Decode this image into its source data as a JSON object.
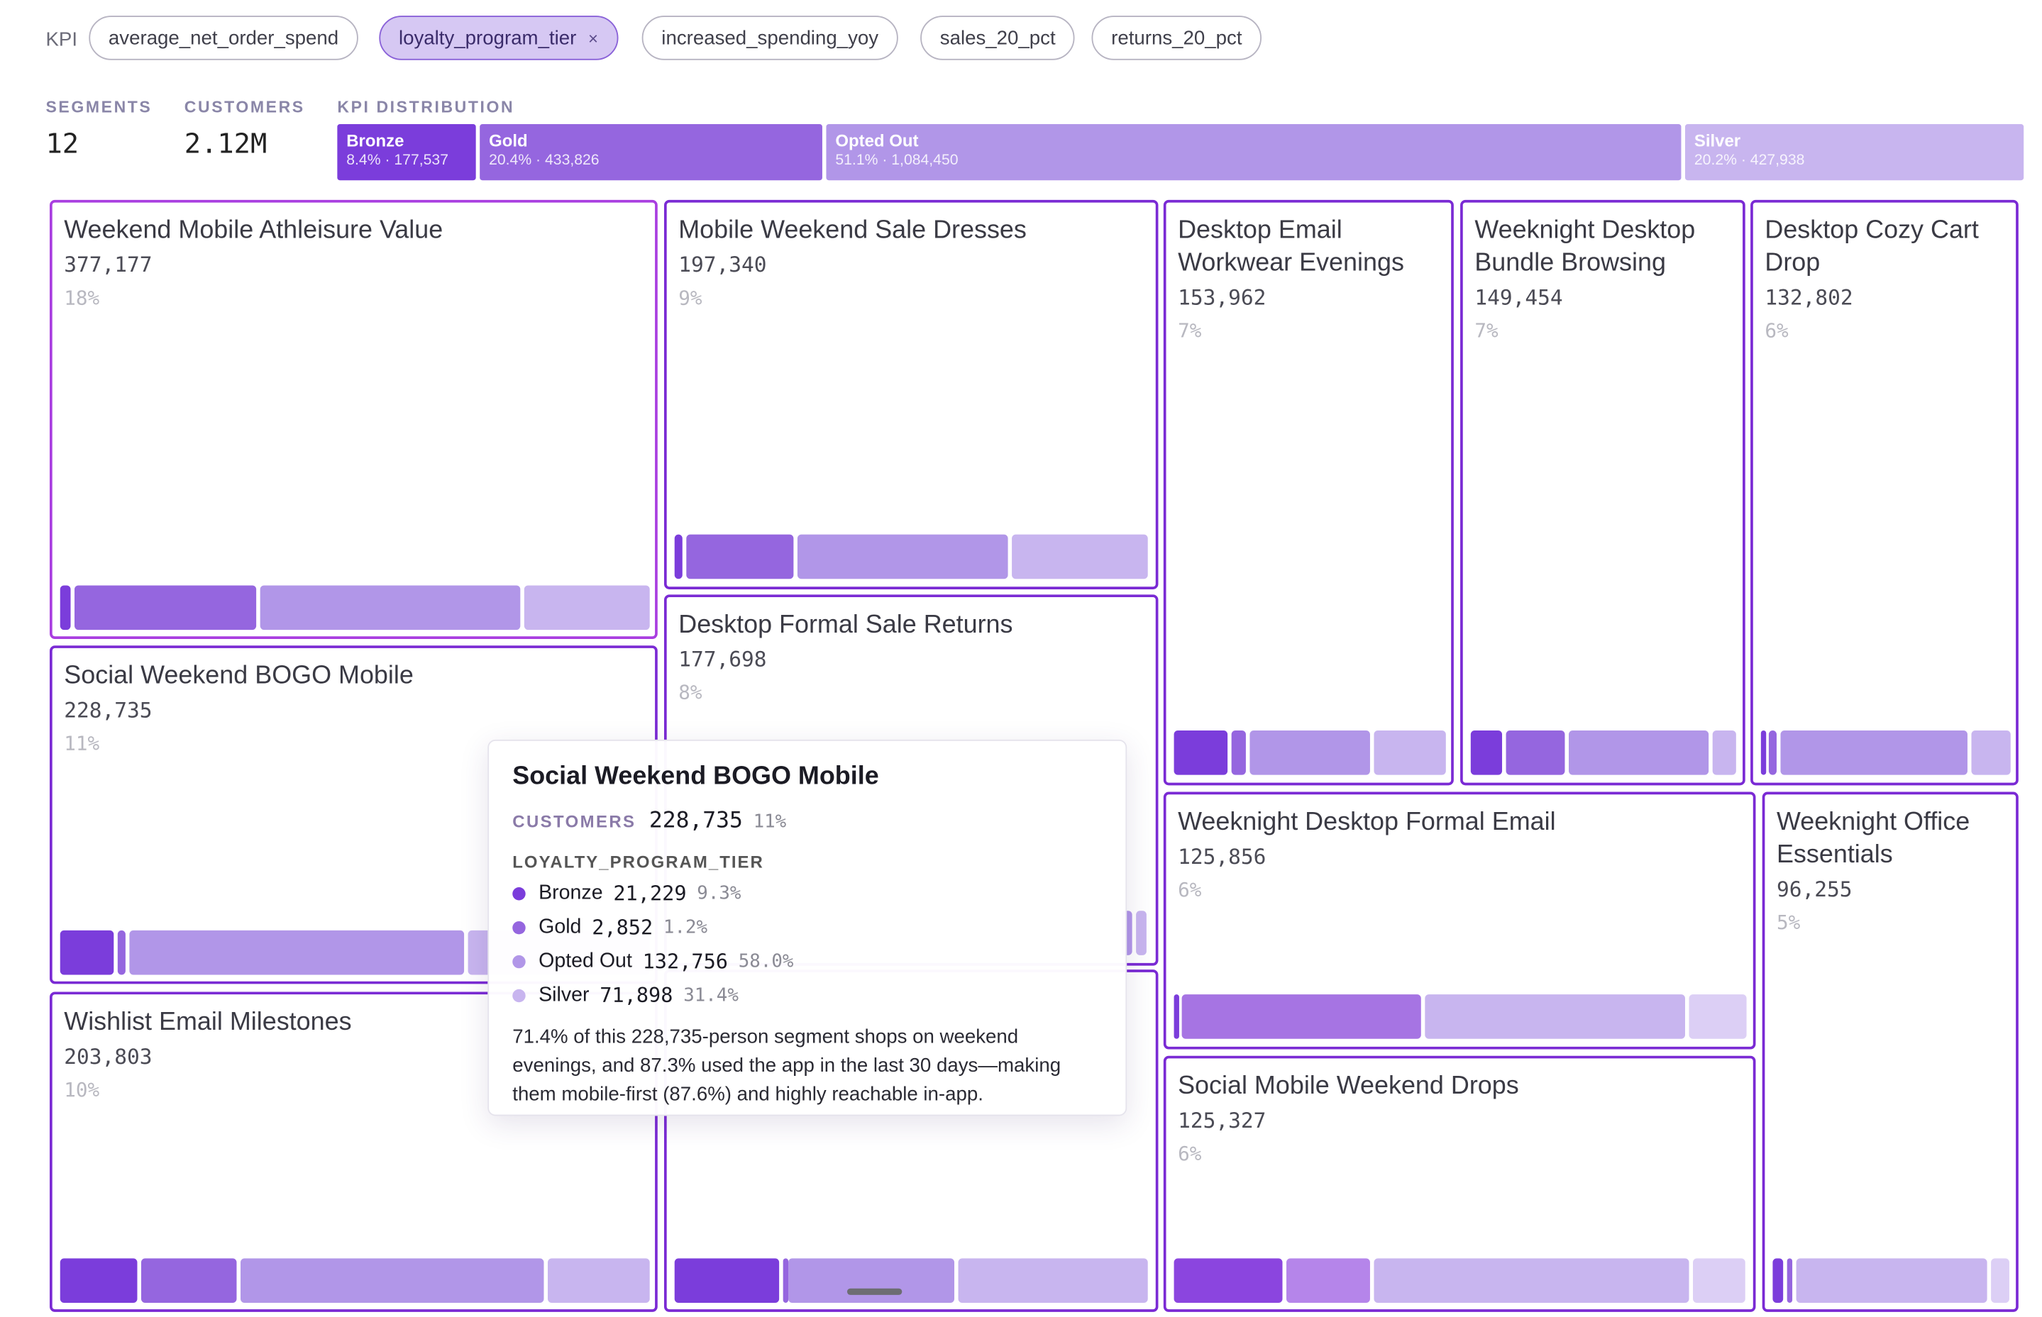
{
  "kpi_bar": {
    "label": "KPI",
    "pills": [
      {
        "label": "average_net_order_spend",
        "selected": false
      },
      {
        "label": "loyalty_program_tier",
        "selected": true,
        "close": "×"
      },
      {
        "label": "increased_spending_yoy",
        "selected": false
      },
      {
        "label": "sales_20_pct",
        "selected": false
      },
      {
        "label": "returns_20_pct",
        "selected": false
      }
    ]
  },
  "stats": {
    "segments_label": "SEGMENTS",
    "segments_value": "12",
    "customers_label": "CUSTOMERS",
    "customers_value": "2.12M",
    "distribution_label": "KPI DISTRIBUTION"
  },
  "distribution": [
    {
      "name": "Bronze",
      "sub": "8.4% · 177,537",
      "share": 0.084,
      "color": "#7b3ddb"
    },
    {
      "name": "Gold",
      "sub": "20.4% · 433,826",
      "share": 0.204,
      "color": "#9566df"
    },
    {
      "name": "Opted Out",
      "sub": "51.1% · 1,084,450",
      "share": 0.511,
      "color": "#b196e8"
    },
    {
      "name": "Silver",
      "sub": "20.2% · 427,938",
      "share": 0.202,
      "color": "#c8b5ef"
    }
  ],
  "segments": [
    {
      "title": "Weekend Mobile Athleisure Value",
      "customers": "377,177",
      "pct": "18%"
    },
    {
      "title": "Social Weekend BOGO Mobile",
      "customers": "228,735",
      "pct": "11%"
    },
    {
      "title": "Wishlist Email Milestones",
      "customers": "203,803",
      "pct": "10%"
    },
    {
      "title": "Mobile Weekend Sale Dresses",
      "customers": "197,340",
      "pct": "9%"
    },
    {
      "title": "Desktop Formal Sale Returns",
      "customers": "177,698",
      "pct": "8%"
    },
    {
      "title": "Desktop Email Workwear Evenings",
      "customers": "153,962",
      "pct": "7%"
    },
    {
      "title": "Weeknight Desktop Bundle Browsing",
      "customers": "149,454",
      "pct": "7%"
    },
    {
      "title": "Desktop Cozy Cart Drop",
      "customers": "132,802",
      "pct": "6%"
    },
    {
      "title": "Weeknight Desktop Formal Email",
      "customers": "125,856",
      "pct": "6%"
    },
    {
      "title": "Social Mobile Weekend Drops",
      "customers": "125,327",
      "pct": "6%"
    },
    {
      "title": "Weeknight Office Essentials",
      "customers": "96,255",
      "pct": "5%"
    }
  ],
  "tooltip": {
    "title": "Social Weekend BOGO Mobile",
    "customers_label": "CUSTOMERS",
    "customers_value": "228,735",
    "customers_pct": "11%",
    "kpi_label": "LOYALTY_PROGRAM_TIER",
    "rows": [
      {
        "label": "Bronze",
        "value": "21,229",
        "pct": "9.3%",
        "color": "#7b3ddb"
      },
      {
        "label": "Gold",
        "value": "2,852",
        "pct": "1.2%",
        "color": "#9566df"
      },
      {
        "label": "Opted Out",
        "value": "132,756",
        "pct": "58.0%",
        "color": "#b196e8"
      },
      {
        "label": "Silver",
        "value": "71,898",
        "pct": "31.4%",
        "color": "#c8b5ef"
      }
    ],
    "description": "71.4% of this 228,735-person segment shops on weekend evenings, and 87.3% used the app in the last 30 days—making them mobile-first (87.6%) and highly reachable in-app."
  }
}
